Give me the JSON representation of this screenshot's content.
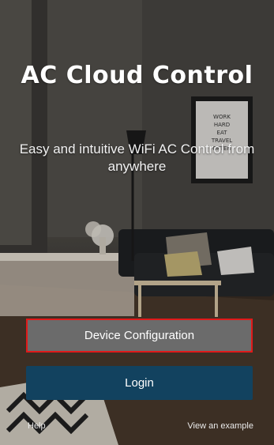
{
  "app": {
    "title": "AC Cloud Control",
    "subtitle": "Easy and intuitive WiFi AC Control from anywhere"
  },
  "background": {
    "poster_text": [
      "WORK",
      "HARD",
      "EAT",
      "TRAVEL",
      "OFTEN"
    ]
  },
  "buttons": {
    "device_configuration": "Device Configuration",
    "login": "Login"
  },
  "footer": {
    "help": "Help",
    "view_example": "View an example"
  },
  "colors": {
    "device_button_bg": "#6b6b6b",
    "device_button_highlight": "#e01a1a",
    "login_button_bg": "#12425f"
  }
}
